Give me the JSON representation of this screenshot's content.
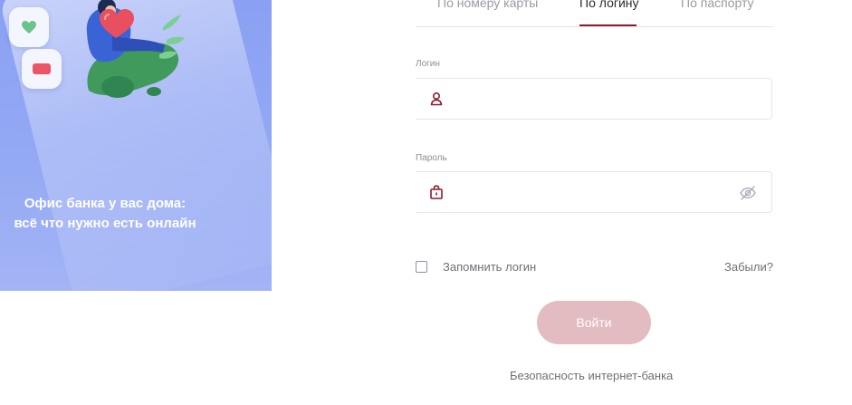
{
  "promo": {
    "title_line1": "Офис банка у вас дома:",
    "title_line2": "всё что нужно есть онлайн",
    "illustration": "person-with-heart-illustration",
    "tile_icons": [
      "heart-icon",
      "card-icon"
    ],
    "colors": {
      "panel": "#93a8f4",
      "heart": "#6cc38a",
      "card": "#ea5567",
      "plant": "#3f9a5c"
    }
  },
  "tabs": {
    "items": [
      {
        "label": "По номеру карты",
        "active": false
      },
      {
        "label": "По логину",
        "active": true
      },
      {
        "label": "По паспорту",
        "active": false
      }
    ],
    "accent_color": "#8c1d2c"
  },
  "login": {
    "label": "Логин",
    "value": "",
    "icon": "user-icon"
  },
  "password": {
    "label": "Пароль",
    "value": "",
    "icon": "lock-icon",
    "toggle_icon": "eye-hidden-icon"
  },
  "remember": {
    "label": "Запомнить логин",
    "checked": false
  },
  "forgot_label": "Забыли?",
  "submit": {
    "label": "Войти",
    "color": "#e2bcc0",
    "enabled": false
  },
  "security_link": "Безопасность интернет-банка"
}
